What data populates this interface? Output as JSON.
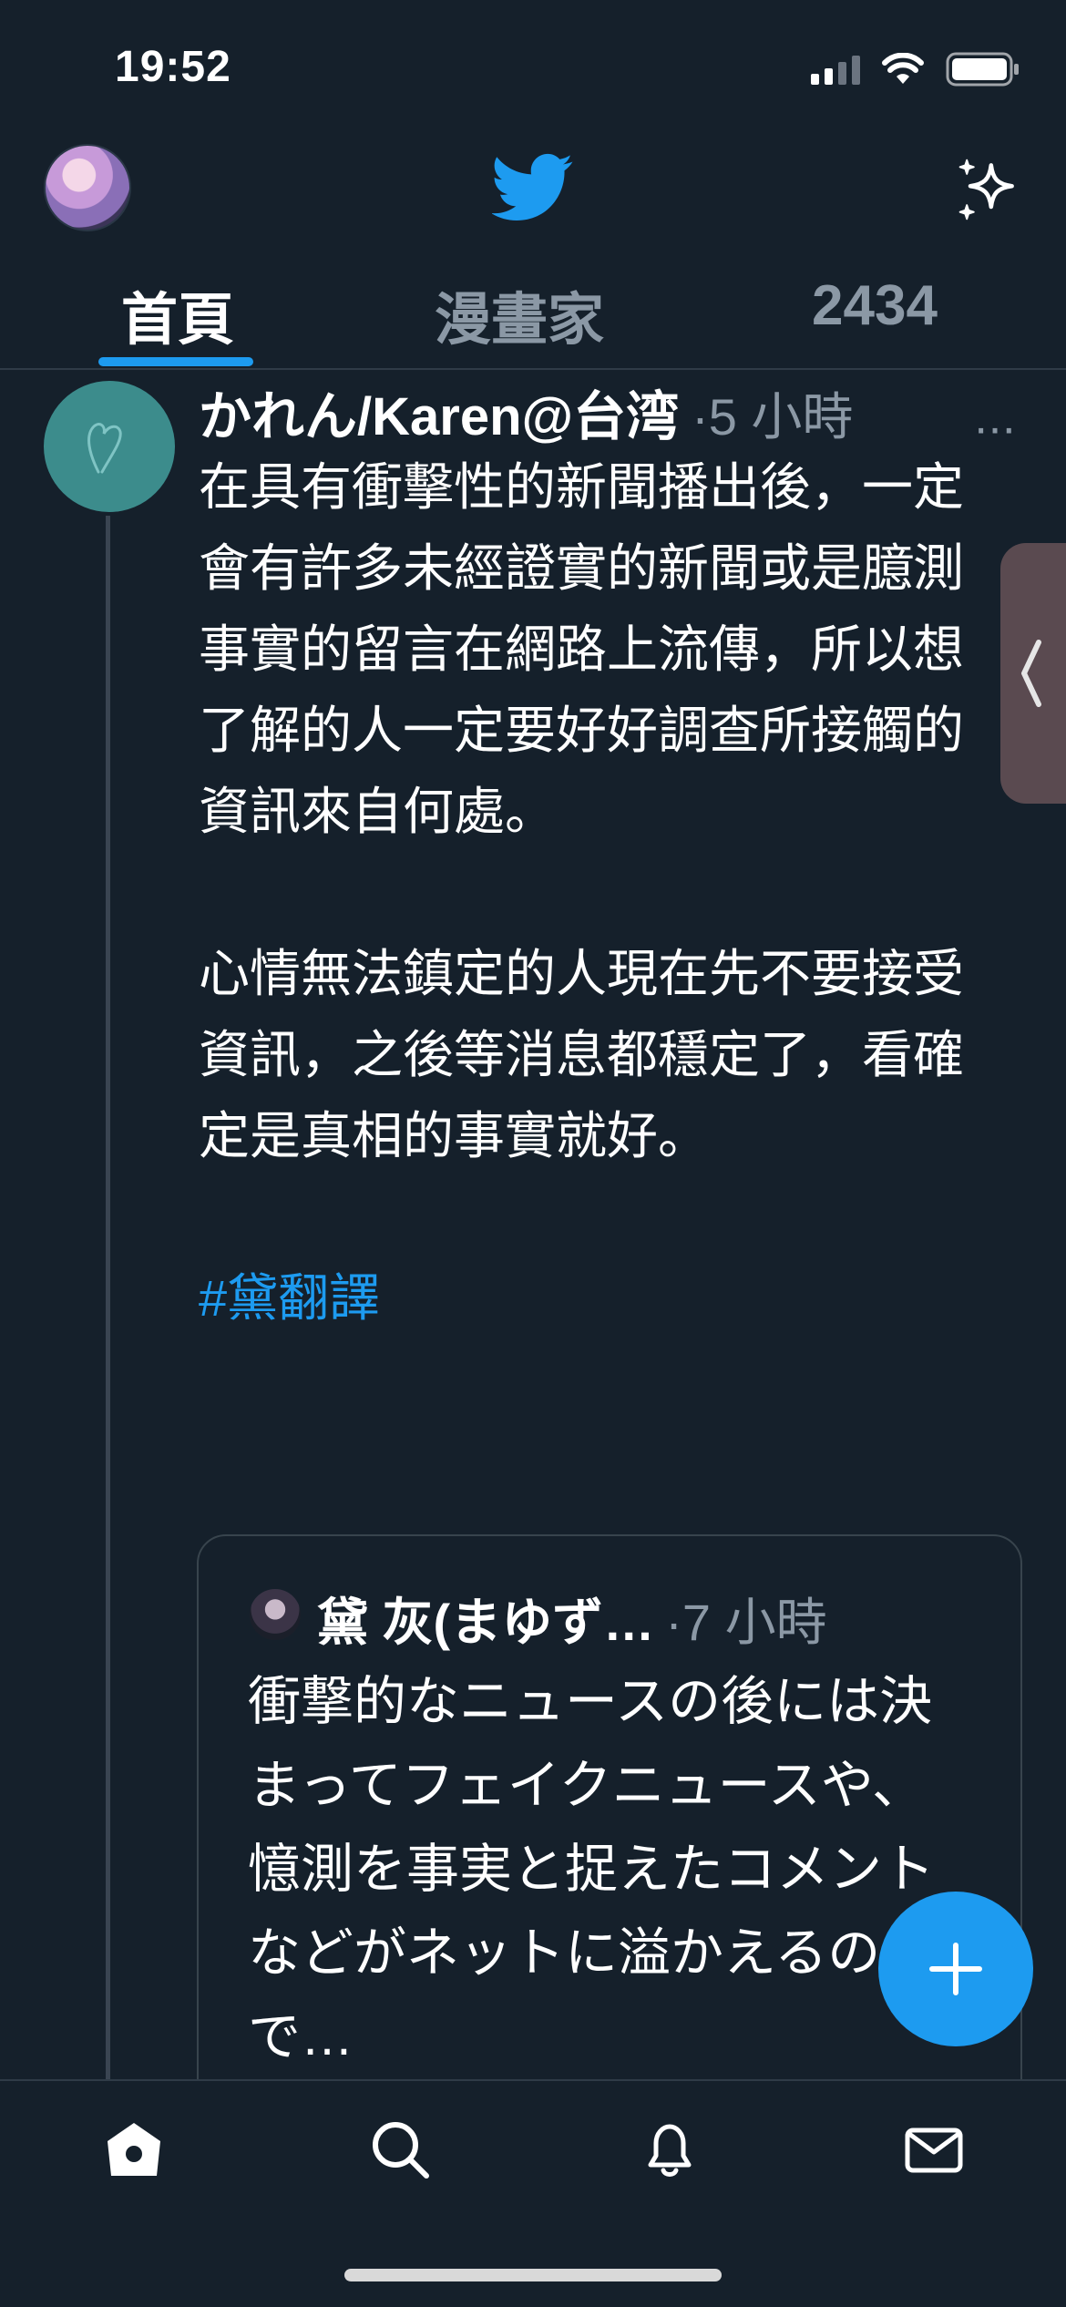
{
  "status_bar": {
    "time": "19:52"
  },
  "tabs": [
    {
      "label": "首頁",
      "active": true
    },
    {
      "label": "漫畫家",
      "active": false
    },
    {
      "label": "2434",
      "active": false
    }
  ],
  "tweet": {
    "author": "かれん/Karen@台湾",
    "time": "·5 小時",
    "more": "···",
    "paragraph1": "在具有衝擊性的新聞播出後，一定會有許多未經證實的新聞或是臆測事實的留言在網路上流傳，所以想了解的人一定要好好調查所接觸的資訊來自何處。",
    "paragraph2": "心情無法鎮定的人現在先不要接受資訊，之後等消息都穩定了，看確定是真相的事實就好。",
    "hashtag": "#黛翻譯",
    "quoted": {
      "author": "黛 灰(まゆず…",
      "time": "·7 小時",
      "text": "衝撃的なニュースの後には決まってフェイクニュースや、憶測を事実と捉えたコメントなどがネットに溢かえるので…"
    }
  },
  "colors": {
    "background": "#15202B",
    "accent": "#1D9BF0",
    "muted": "#8B98A5"
  },
  "icons": {
    "header": [
      "profile-avatar",
      "twitter-bird-icon",
      "sparkle-icon"
    ],
    "bottom_nav": [
      "home-icon",
      "search-icon",
      "notifications-icon",
      "messages-icon"
    ],
    "compose": "plus-icon"
  }
}
